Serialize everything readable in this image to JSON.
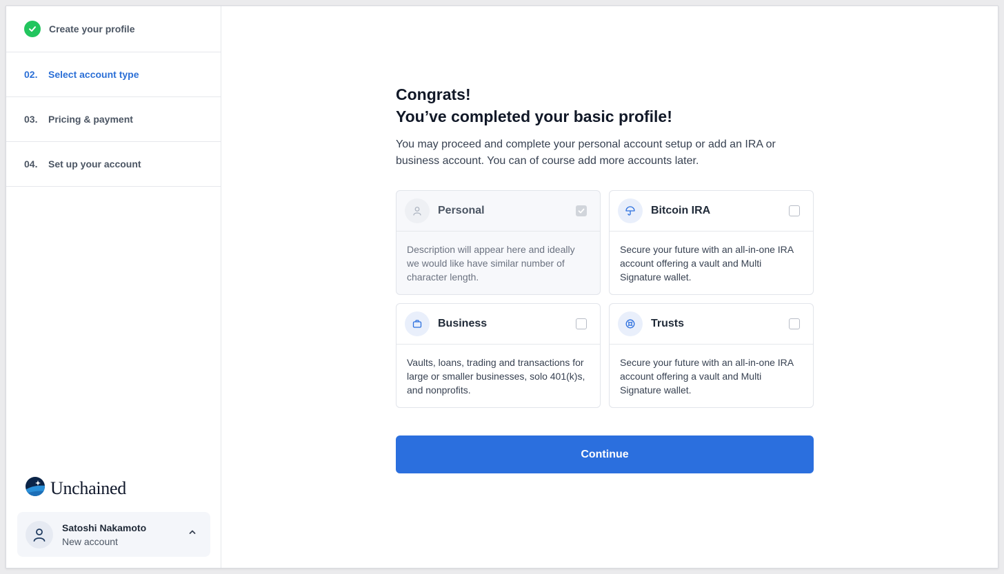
{
  "steps": [
    {
      "label": "Create your profile"
    },
    {
      "num": "02.",
      "label": "Select account type"
    },
    {
      "num": "03.",
      "label": "Pricing & payment"
    },
    {
      "num": "04.",
      "label": "Set up your account"
    }
  ],
  "brand": {
    "name": "Unchained"
  },
  "user": {
    "name": "Satoshi Nakamoto",
    "subtitle": "New account"
  },
  "main": {
    "title_line1": "Congrats!",
    "title_line2": "You’ve completed your basic profile!",
    "description": "You may proceed and complete your personal account setup or add an IRA or business account. You can of course add more accounts later."
  },
  "cards": [
    {
      "title": "Personal",
      "icon": "user-icon",
      "checked": true,
      "disabled": true,
      "description": "Description will appear here and ideally we would like have similar number of character length."
    },
    {
      "title": "Bitcoin IRA",
      "icon": "umbrella-icon",
      "checked": false,
      "description": "Secure your future with an all-in-one IRA account offering a vault and Multi Signature wallet."
    },
    {
      "title": "Business",
      "icon": "briefcase-icon",
      "checked": false,
      "description": "Vaults, loans, trading and transactions for large or smaller businesses, solo 401(k)s, and nonprofits."
    },
    {
      "title": "Trusts",
      "icon": "trust-icon",
      "checked": false,
      "description": "Secure your future with an all-in-one IRA account offering a vault and Multi Signature wallet."
    }
  ],
  "continue_label": "Continue",
  "colors": {
    "accent": "#2b6fde",
    "success": "#22c55e",
    "active_step": "#2b6fd6"
  }
}
